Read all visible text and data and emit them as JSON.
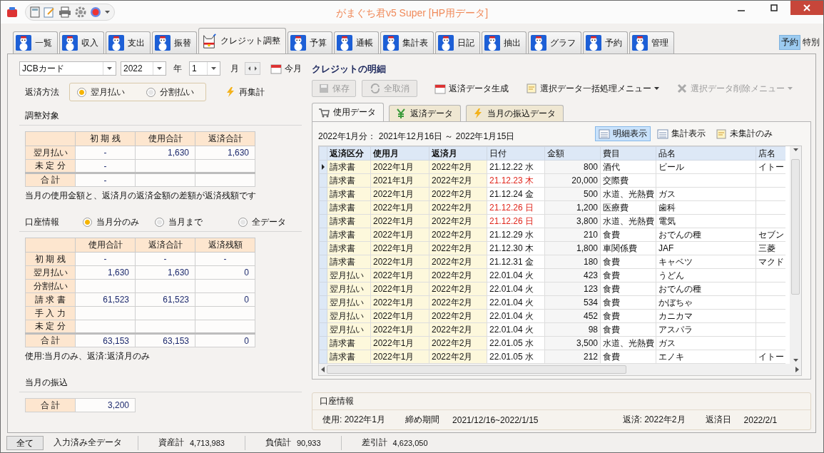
{
  "window": {
    "title": "がまぐち君v5 Super  [HP用データ]"
  },
  "main_tabs": [
    {
      "label": "一覧",
      "selected": false
    },
    {
      "label": "収入",
      "selected": false
    },
    {
      "label": "支出",
      "selected": false
    },
    {
      "label": "振替",
      "selected": false
    },
    {
      "label": "クレジット調整",
      "selected": true
    },
    {
      "label": "予算",
      "selected": false
    },
    {
      "label": "通帳",
      "selected": false
    },
    {
      "label": "集計表",
      "selected": false
    },
    {
      "label": "日記",
      "selected": false
    },
    {
      "label": "抽出",
      "selected": false
    },
    {
      "label": "グラフ",
      "selected": false
    },
    {
      "label": "予約",
      "selected": false
    },
    {
      "label": "管理",
      "selected": false
    }
  ],
  "mode_toggle": [
    {
      "label": "予約",
      "selected": true
    },
    {
      "label": "特別",
      "selected": false
    }
  ],
  "left": {
    "card": "JCBカード",
    "year": "2022",
    "year_unit": "年",
    "month": "1",
    "month_unit": "月",
    "today_button": "今月",
    "repayment_method": {
      "label": "返済方法",
      "options": [
        {
          "label": "翌月払い",
          "selected": true
        },
        {
          "label": "分割払い",
          "selected": false
        }
      ]
    },
    "recalc_button": "再集計",
    "adjustment": {
      "title": "調整対象",
      "columns": [
        "",
        "初 期 残",
        "使用合計",
        "返済合計"
      ],
      "rows": [
        {
          "kind": "row",
          "cells": [
            "翌月払い",
            "-",
            "1,630",
            "1,630"
          ]
        },
        {
          "kind": "row",
          "cells": [
            "未 定 分",
            "-",
            null,
            null
          ]
        },
        {
          "kind": "total",
          "cells": [
            "合 計",
            "-",
            null,
            null
          ]
        }
      ],
      "note": "当月の使用金額と、返済月の返済金額の差額が返済残額です"
    },
    "account": {
      "title": "口座情報",
      "scope": [
        {
          "label": "当月分のみ",
          "selected": true
        },
        {
          "label": "当月まで",
          "selected": false
        },
        {
          "label": "全データ",
          "selected": false
        }
      ],
      "columns": [
        "",
        "使用合計",
        "返済合計",
        "返済残額"
      ],
      "rows": [
        {
          "kind": "row",
          "cells": [
            "初 期 残",
            "-",
            "-",
            "-"
          ]
        },
        {
          "kind": "row",
          "cells": [
            "翌月払い",
            "1,630",
            "1,630",
            "0"
          ]
        },
        {
          "kind": "row",
          "cells": [
            "分割払い",
            null,
            null,
            null
          ]
        },
        {
          "kind": "row",
          "cells": [
            "請 求 書",
            "61,523",
            "61,523",
            "0"
          ]
        },
        {
          "kind": "row",
          "cells": [
            "手 入 力",
            null,
            null,
            null
          ]
        },
        {
          "kind": "row",
          "cells": [
            "未 定 分",
            null,
            null,
            null
          ]
        },
        {
          "kind": "total",
          "cells": [
            "合 計",
            "63,153",
            "63,153",
            "0"
          ]
        }
      ],
      "note": "使用:当月のみ、返済:返済月のみ"
    },
    "transfer": {
      "title": "当月の振込",
      "rows": [
        {
          "cells": [
            "合 計",
            "3,200"
          ]
        }
      ]
    }
  },
  "right": {
    "title": "クレジットの明細",
    "toolbar": [
      {
        "kind": "button",
        "label": "保存",
        "disabled": true
      },
      {
        "kind": "button",
        "label": "全取消",
        "disabled": true
      },
      {
        "kind": "action",
        "label": "返済データ生成",
        "disabled": false
      },
      {
        "kind": "menu",
        "label": "選択データ一括処理メニュー",
        "disabled": false
      },
      {
        "kind": "menu",
        "label": "選択データ削除メニュー",
        "disabled": true
      }
    ],
    "tabs": [
      {
        "label": "使用データ",
        "selected": true
      },
      {
        "label": "返済データ",
        "selected": false
      },
      {
        "label": "当月の振込データ",
        "selected": false
      }
    ],
    "period": "2022年1月分：  2021年12月16日 ～ 2022年1月15日",
    "views": [
      {
        "label": "明細表示",
        "selected": true
      },
      {
        "label": "集計表示",
        "selected": false
      },
      {
        "label": "未集計のみ",
        "selected": false
      }
    ],
    "grid": {
      "columns": [
        "返済区分",
        "使用月",
        "返済月",
        "日付",
        "金額",
        "費目",
        "品名",
        "店名"
      ],
      "rows": [
        {
          "current": true,
          "holiday": false,
          "cells": [
            "請求書",
            "2022年1月",
            "2022年2月",
            "21.12.22 水",
            "800",
            "酒代",
            "ビール",
            "イトー"
          ]
        },
        {
          "current": false,
          "holiday": true,
          "cells": [
            "請求書",
            "2021年1月",
            "2022年2月",
            "21.12.23 木",
            "20,000",
            "交際費",
            null,
            null
          ]
        },
        {
          "current": false,
          "holiday": false,
          "cells": [
            "請求書",
            "2022年1月",
            "2022年2月",
            "21.12.24 金",
            "500",
            "水道、光熱費",
            "ガス",
            null
          ]
        },
        {
          "current": false,
          "holiday": true,
          "cells": [
            "請求書",
            "2022年1月",
            "2022年2月",
            "21.12.26 日",
            "1,200",
            "医療費",
            "歯科",
            null
          ]
        },
        {
          "current": false,
          "holiday": true,
          "cells": [
            "請求書",
            "2022年1月",
            "2022年2月",
            "21.12.26 日",
            "3,800",
            "水道、光熱費",
            "電気",
            null
          ]
        },
        {
          "current": false,
          "holiday": false,
          "cells": [
            "請求書",
            "2022年1月",
            "2022年2月",
            "21.12.29 水",
            "210",
            "食費",
            "おでんの種",
            "セブン"
          ]
        },
        {
          "current": false,
          "holiday": false,
          "cells": [
            "請求書",
            "2022年1月",
            "2022年2月",
            "21.12.30 木",
            "1,800",
            "車関係費",
            "JAF",
            "三菱"
          ]
        },
        {
          "current": false,
          "holiday": false,
          "cells": [
            "請求書",
            "2022年1月",
            "2022年2月",
            "21.12.31 金",
            "180",
            "食費",
            "キャベツ",
            "マクド"
          ]
        },
        {
          "current": false,
          "holiday": false,
          "cells": [
            "翌月払い",
            "2022年1月",
            "2022年2月",
            "22.01.04 火",
            "423",
            "食費",
            "うどん",
            null
          ]
        },
        {
          "current": false,
          "holiday": false,
          "cells": [
            "翌月払い",
            "2022年1月",
            "2022年2月",
            "22.01.04 火",
            "123",
            "食費",
            "おでんの種",
            null
          ]
        },
        {
          "current": false,
          "holiday": false,
          "cells": [
            "翌月払い",
            "2022年1月",
            "2022年2月",
            "22.01.04 火",
            "534",
            "食費",
            "かぼちゃ",
            null
          ]
        },
        {
          "current": false,
          "holiday": false,
          "cells": [
            "翌月払い",
            "2022年1月",
            "2022年2月",
            "22.01.04 火",
            "452",
            "食費",
            "カニカマ",
            null
          ]
        },
        {
          "current": false,
          "holiday": false,
          "cells": [
            "翌月払い",
            "2022年1月",
            "2022年2月",
            "22.01.04 火",
            "98",
            "食費",
            "アスパラ",
            null
          ]
        },
        {
          "current": false,
          "holiday": false,
          "cells": [
            "請求書",
            "2022年1月",
            "2022年2月",
            "22.01.05 水",
            "3,500",
            "水道、光熱費",
            "ガス",
            null
          ]
        },
        {
          "current": false,
          "holiday": false,
          "cells": [
            "請求書",
            "2022年1月",
            "2022年2月",
            "22.01.05 水",
            "212",
            "食費",
            "エノキ",
            "イトー"
          ]
        }
      ]
    },
    "account_info": {
      "title": "口座情報",
      "items": [
        {
          "label": "使用: 2022年1月"
        },
        {
          "label": "締め期間",
          "value": "2021/12/16~2022/1/15"
        },
        {
          "label": "返済: 2022年2月"
        },
        {
          "label": "返済日",
          "value": "2022/2/1"
        }
      ]
    }
  },
  "status_bar": {
    "button": "全て",
    "scope": "入力済み全データ",
    "totals": [
      {
        "label": "資産計",
        "value": "4,713,983"
      },
      {
        "label": "負債計",
        "value": "90,933"
      },
      {
        "label": "差引計",
        "value": "4,623,050"
      }
    ]
  }
}
